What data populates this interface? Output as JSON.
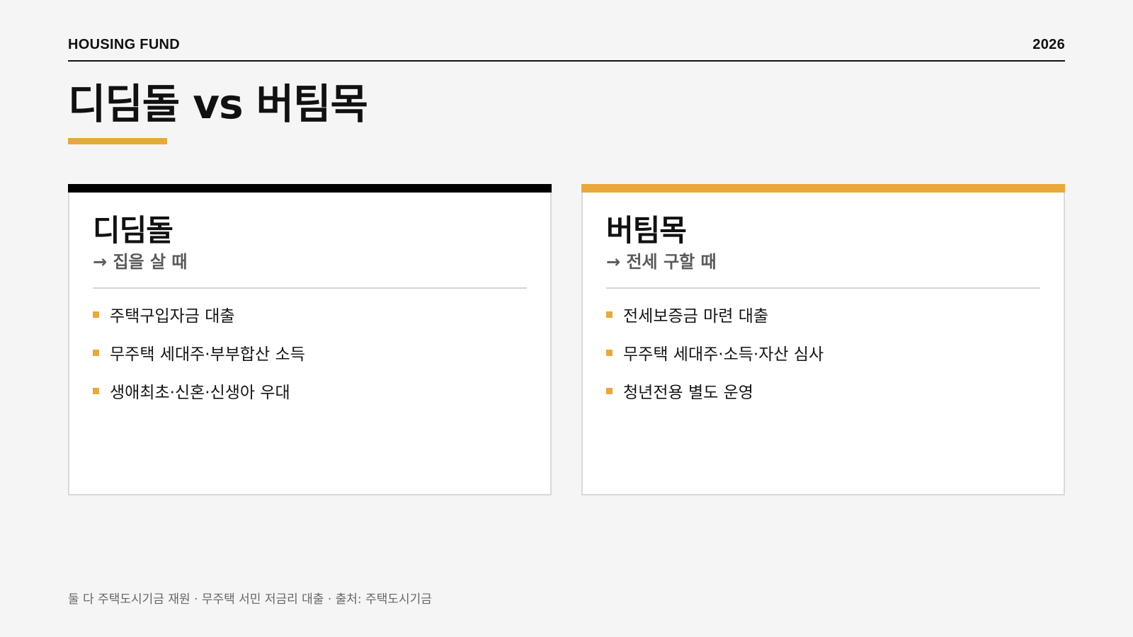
{
  "header": {
    "brand": "HOUSING FUND",
    "year": "2026"
  },
  "title": "디딤돌 vs 버팀목",
  "colors": {
    "accent": "#e8a83a",
    "dark": "#000000",
    "card_border": "#d9d9d9"
  },
  "cards": [
    {
      "title": "디딤돌",
      "subtitle": "→ 집을 살 때",
      "items": [
        "주택구입자금 대출",
        "무주택 세대주·부부합산 소득",
        "생애최초·신혼·신생아 우대"
      ]
    },
    {
      "title": "버팀목",
      "subtitle": "→ 전세 구할 때",
      "items": [
        "전세보증금 마련 대출",
        "무주택 세대주·소득·자산 심사",
        "청년전용 별도 운영"
      ]
    }
  ],
  "footer": "둘 다 주택도시기금 재원 · 무주택 서민 저금리 대출 · 출처: 주택도시기금"
}
